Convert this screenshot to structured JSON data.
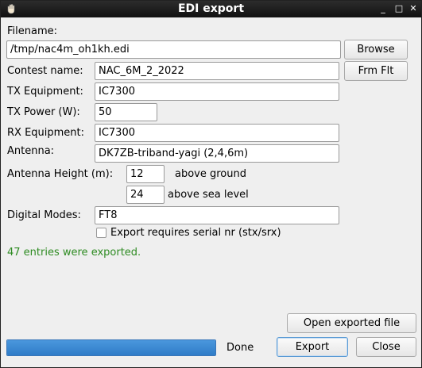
{
  "window": {
    "title": "EDI export",
    "controls": {
      "minimize": "_",
      "maximize": "□",
      "close": "✕"
    }
  },
  "form": {
    "filename_label": "Filename:",
    "filename_value": "/tmp/nac4m_oh1kh.edi",
    "browse_label": "Browse",
    "contest_label": "Contest name:",
    "contest_value": "NAC_6M_2_2022",
    "frmflt_label": "Frm Flt",
    "tx_equipment_label": "TX Equipment:",
    "tx_equipment_value": "IC7300",
    "tx_power_label": "TX Power (W):",
    "tx_power_value": "50",
    "rx_equipment_label": "RX Equipment:",
    "rx_equipment_value": "IC7300",
    "antenna_label": "Antenna:",
    "antenna_value": "DK7ZB-triband-yagi (2,4,6m)",
    "antenna_height_label": "Antenna Height (m):",
    "height_ground_value": "12",
    "above_ground_label": "above ground",
    "height_sea_value": "24",
    "above_sea_label": "above sea level",
    "digital_modes_label": "Digital Modes:",
    "digital_modes_value": "FT8",
    "serial_checkbox_label": "Export requires serial nr (stx/srx)",
    "serial_checked": false
  },
  "status": {
    "message": "47 entries were exported.",
    "message_color": "#2e8b22"
  },
  "footer": {
    "open_file_label": "Open exported file",
    "progress_percent": 100,
    "progress_color": "#3a86d0",
    "progress_text": "Done",
    "export_label": "Export",
    "close_label": "Close"
  }
}
